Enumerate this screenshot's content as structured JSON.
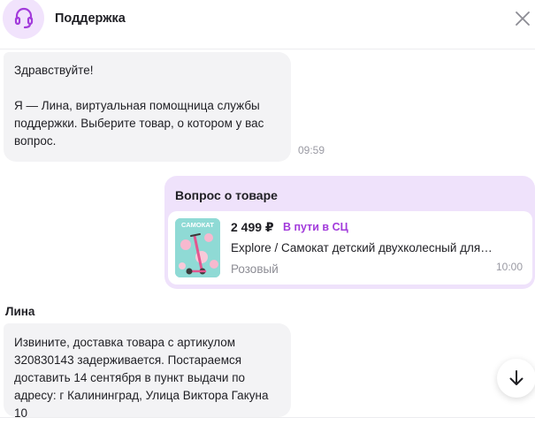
{
  "header": {
    "title": "Поддержка",
    "avatar_icon": "headset-icon",
    "close_icon": "close-icon",
    "accent": "#a23bdb"
  },
  "messages": {
    "greeting": {
      "line1": "Здравствуйте!",
      "line2": "Я — Лина, виртуальная помощница службы",
      "line3": "поддержки. Выберите товар, о котором у вас",
      "line4": "вопрос.",
      "time": "09:59"
    },
    "question": {
      "title": "Вопрос о товаре",
      "product": {
        "price": "2 499 ₽",
        "status": "В пути в СЦ",
        "name": "Explore / Самокат детский двухколесный для…",
        "color": "Розовый",
        "thumb_text": "САМОКАТ",
        "time": "10:00"
      }
    },
    "reply": {
      "sender": "Лина",
      "line1": "Извините, доставка товара с артикулом",
      "line2": "320830143 задерживается. Постараемся",
      "line3": "доставить 14 сентября в пункт выдачи по",
      "line4": "адресу: г Калининград, Улица Виктора Гакуна",
      "line5": "10"
    }
  },
  "scroll_button": {
    "icon": "arrow-down-icon"
  }
}
